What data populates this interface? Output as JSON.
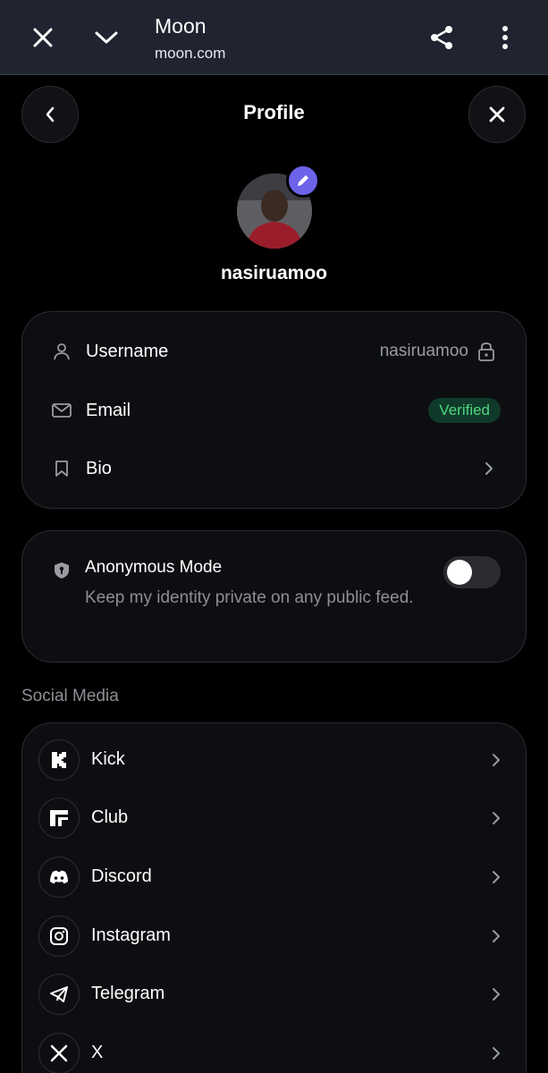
{
  "browser": {
    "title": "Moon",
    "url": "moon.com"
  },
  "header": {
    "title": "Profile"
  },
  "profile": {
    "display_name": "nasiruamoo"
  },
  "account": {
    "rows": [
      {
        "label": "Username",
        "value": "nasiruamoo"
      },
      {
        "label": "Email",
        "badge": "Verified"
      },
      {
        "label": "Bio"
      }
    ]
  },
  "anonymous": {
    "title": "Anonymous Mode",
    "description": "Keep my identity private on any public feed.",
    "enabled": false
  },
  "social": {
    "section_label": "Social Media",
    "items": [
      {
        "label": "Kick",
        "icon": "kick-icon"
      },
      {
        "label": "Club",
        "icon": "club-icon"
      },
      {
        "label": "Discord",
        "icon": "discord-icon"
      },
      {
        "label": "Instagram",
        "icon": "instagram-icon"
      },
      {
        "label": "Telegram",
        "icon": "telegram-icon"
      },
      {
        "label": "X",
        "icon": "x-icon"
      }
    ]
  },
  "colors": {
    "accent": "#6d63e8",
    "verified_text": "#4fd67f",
    "verified_bg": "#0f3a2a",
    "chrome_bg": "#1f2430"
  }
}
